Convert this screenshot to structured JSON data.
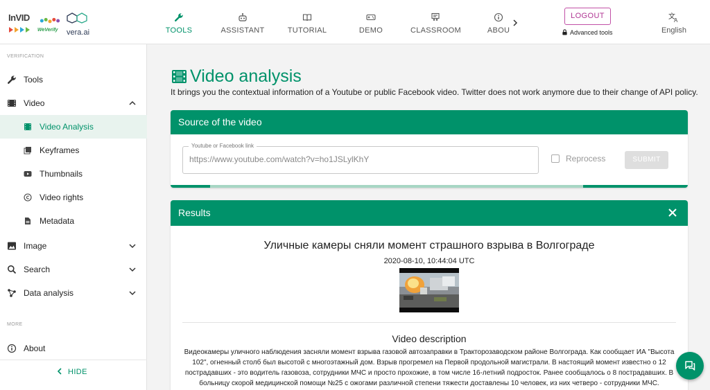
{
  "brand": {
    "invid": "InVID",
    "weverify": "WeVerify",
    "vera": "vera.ai",
    "colors": {
      "primary": "#00926a",
      "logout": "#b03593"
    }
  },
  "nav": {
    "items": [
      {
        "label": "TOOLS",
        "icon": "wrench-icon",
        "active": true
      },
      {
        "label": "ASSISTANT",
        "icon": "robot-icon"
      },
      {
        "label": "TUTORIAL",
        "icon": "book-icon"
      },
      {
        "label": "DEMO",
        "icon": "gamepad-icon"
      },
      {
        "label": "CLASSROOM",
        "icon": "classroom-icon"
      },
      {
        "label": "ABOU",
        "icon": "info-icon"
      }
    ],
    "logout_label": "LOGOUT",
    "advanced_tools": "Advanced tools",
    "language": "English"
  },
  "sidebar": {
    "section_verification": "VERIFICATION",
    "section_more": "MORE",
    "items": {
      "tools": "Tools",
      "video": "Video",
      "video_analysis": "Video Analysis",
      "keyframes": "Keyframes",
      "thumbnails": "Thumbnails",
      "video_rights": "Video rights",
      "metadata": "Metadata",
      "image": "Image",
      "search": "Search",
      "data_analysis": "Data analysis",
      "about": "About"
    },
    "hide_label": "HIDE"
  },
  "main": {
    "title": "Video analysis",
    "description": "It brings you the contextual information of a Youtube or public Facebook video. Twitter does not work anymore due to their change of API policy.",
    "source_card": {
      "title": "Source of the video",
      "field_label": "Youtube or Facebook link",
      "field_value": "https://www.youtube.com/watch?v=ho1JSLylKhY",
      "reprocess_label": "Reprocess",
      "submit_label": "SUBMIT"
    },
    "results_card": {
      "title": "Results",
      "video_title": "Уличные камеры сняли момент страшного взрыва в Волгограде",
      "video_date": "2020-08-10, 10:44:04 UTC",
      "desc_title": "Video description",
      "desc_body": "Видеокамеры уличного наблюдения засняли момент взрыва газовой автозаправки в Тракторозаводском районе Волгограда. Как сообщает ИА \"Высота 102\", огненный столб был высотой с многоэтажный дом. Взрыв прогремел на Первой продольной магистрали. В настоящий момент известно о 12 пострадавших - это водитель газовоза, сотрудники МЧС и просто прохожие, в том числе 16-летний подросток. Ранее сообщалось о 8 пострадавших. В больницу скорой медицинской помощи №25 с ожогами различной степени тяжести доставлены 10 человек, из них четверо - сотрудники МЧС."
    }
  }
}
